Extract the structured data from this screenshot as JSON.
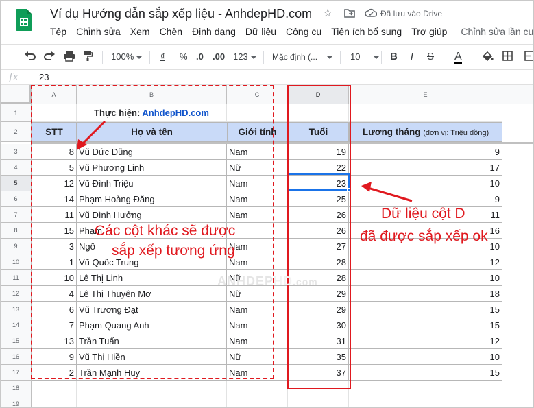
{
  "app": {
    "doc_title": "Ví dụ Hướng dẫn sắp xếp liệu - AnhdepHD.com",
    "saved_status": "Đã lưu vào Drive",
    "icons": [
      "star-icon",
      "move-folder-icon",
      "cloud-saved-icon"
    ]
  },
  "menu": {
    "items": [
      "Tệp",
      "Chỉnh sửa",
      "Xem",
      "Chèn",
      "Định dạng",
      "Dữ liệu",
      "Công cụ",
      "Tiện ích bổ sung",
      "Trợ giúp"
    ],
    "last_edit": "Chỉnh sửa lần cu"
  },
  "toolbar": {
    "zoom": "100%",
    "currency": "₫",
    "percent": "%",
    "decrease_decimal": ".0",
    "increase_decimal": ".00",
    "more_formats": "123",
    "font": "Mặc định (...",
    "font_size": "10",
    "icons": [
      "undo-icon",
      "redo-icon",
      "print-icon",
      "paint-format-icon",
      "text-color-icon",
      "fill-color-icon",
      "borders-icon"
    ]
  },
  "formula": {
    "label": "fx",
    "value": "23"
  },
  "grid": {
    "columns": [
      "A",
      "B",
      "C",
      "D",
      "E"
    ],
    "rows": [
      "1",
      "2",
      "3",
      "4",
      "5",
      "6",
      "7",
      "8",
      "9",
      "10",
      "11",
      "12",
      "13",
      "14",
      "15",
      "16",
      "17",
      "18",
      "19"
    ],
    "credit_label": "Thực hiện: ",
    "credit_link": "AnhdepHD.com",
    "headers": {
      "stt": "STT",
      "name": "Họ và tên",
      "gender": "Giới tính",
      "age": "Tuổi",
      "salary": "Lương tháng",
      "salary_unit": "(đơn vị: Triệu đồng)"
    },
    "data": [
      [
        "8",
        "Vũ Đức Dũng",
        "Nam",
        "19",
        "9"
      ],
      [
        "5",
        "Vũ Phương Linh",
        "Nữ",
        "22",
        "17"
      ],
      [
        "12",
        "Vũ Đình Triệu",
        "Nam",
        "23",
        "10"
      ],
      [
        "14",
        "Phạm Hoàng Đăng",
        "Nam",
        "25",
        "9"
      ],
      [
        "11",
        "Vũ Đình Hưởng",
        "Nam",
        "26",
        "11"
      ],
      [
        "15",
        "Phạm",
        "",
        "26",
        "16"
      ],
      [
        "3",
        "Ngô",
        "Nam",
        "27",
        "10"
      ],
      [
        "1",
        "Vũ Quốc Trung",
        "Nam",
        "28",
        "12"
      ],
      [
        "10",
        "Lê Thị Linh",
        "Nữ",
        "28",
        "10"
      ],
      [
        "4",
        "Lê Thị Thuyên Mơ",
        "Nữ",
        "29",
        "18"
      ],
      [
        "6",
        "Vũ Trương Đạt",
        "Nam",
        "29",
        "15"
      ],
      [
        "7",
        "Phạm Quang Anh",
        "Nam",
        "30",
        "15"
      ],
      [
        "13",
        "Trần Tuấn",
        "Nam",
        "31",
        "12"
      ],
      [
        "9",
        "Vũ Thị Hiền",
        "Nữ",
        "35",
        "10"
      ],
      [
        "2",
        "Trần Mạnh Huy",
        "Nam",
        "37",
        "15"
      ]
    ]
  },
  "annotations": {
    "left_note_line1": "Các cột khác sẽ được",
    "left_note_line2": "sắp xếp tương ứng",
    "right_note_line1": "Dữ liệu cột D",
    "right_note_line2": "đã được sắp xếp ok",
    "watermark_1": "ANHDEP",
    "watermark_2": "HD",
    "watermark_3": ".com",
    "color": "#e0191f"
  },
  "colors": {
    "header_fill": "#c9daf8",
    "selection": "#1a73e8",
    "link": "#1155cc",
    "sheets_green": "#0f9d58"
  }
}
